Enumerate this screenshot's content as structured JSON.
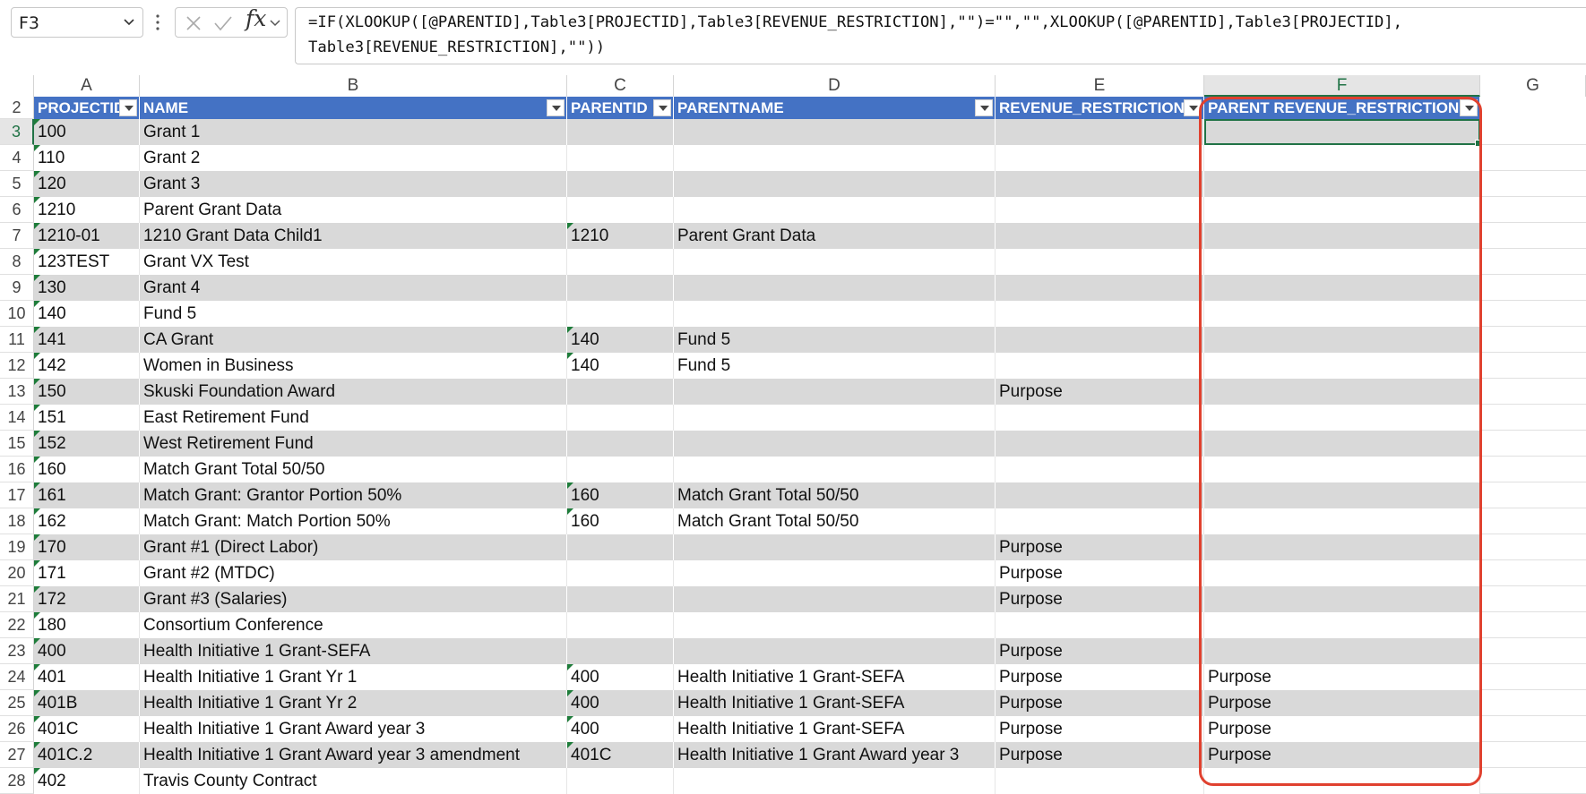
{
  "name_box": {
    "value": "F3"
  },
  "formula_bar": {
    "line1": "=IF(XLOOKUP([@PARENTID],Table3[PROJECTID],Table3[REVENUE_RESTRICTION],\"\")=\"\",\"\",XLOOKUP([@PARENTID],Table3[PROJECTID],",
    "line2": "Table3[REVENUE_RESTRICTION],\"\"))",
    "fx_label": "fx"
  },
  "columns": [
    "A",
    "B",
    "C",
    "D",
    "E",
    "F",
    "G"
  ],
  "table": {
    "header_row": "2",
    "headers": [
      "PROJECTID",
      "NAME",
      "PARENTID",
      "PARENTNAME",
      "REVENUE_RESTRICTION",
      "PARENT REVENUE_RESTRICTION"
    ],
    "rows": [
      {
        "row": "3",
        "projectid": "100",
        "name": "Grant 1",
        "parentid": "",
        "parentname": "",
        "rev": "",
        "parent_rev": ""
      },
      {
        "row": "4",
        "projectid": "110",
        "name": "Grant 2",
        "parentid": "",
        "parentname": "",
        "rev": "",
        "parent_rev": ""
      },
      {
        "row": "5",
        "projectid": "120",
        "name": "Grant 3",
        "parentid": "",
        "parentname": "",
        "rev": "",
        "parent_rev": ""
      },
      {
        "row": "6",
        "projectid": "1210",
        "name": "Parent Grant Data",
        "parentid": "",
        "parentname": "",
        "rev": "",
        "parent_rev": ""
      },
      {
        "row": "7",
        "projectid": "1210-01",
        "name": "1210 Grant Data Child1",
        "parentid": "1210",
        "parentname": "Parent Grant Data",
        "rev": "",
        "parent_rev": ""
      },
      {
        "row": "8",
        "projectid": "123TEST",
        "name": "Grant VX Test",
        "parentid": "",
        "parentname": "",
        "rev": "",
        "parent_rev": ""
      },
      {
        "row": "9",
        "projectid": "130",
        "name": "Grant 4",
        "parentid": "",
        "parentname": "",
        "rev": "",
        "parent_rev": ""
      },
      {
        "row": "10",
        "projectid": "140",
        "name": "Fund 5",
        "parentid": "",
        "parentname": "",
        "rev": "",
        "parent_rev": ""
      },
      {
        "row": "11",
        "projectid": "141",
        "name": "CA Grant",
        "parentid": "140",
        "parentname": "Fund 5",
        "rev": "",
        "parent_rev": ""
      },
      {
        "row": "12",
        "projectid": "142",
        "name": "Women in Business",
        "parentid": "140",
        "parentname": "Fund 5",
        "rev": "",
        "parent_rev": ""
      },
      {
        "row": "13",
        "projectid": "150",
        "name": "Skuski Foundation Award",
        "parentid": "",
        "parentname": "",
        "rev": "Purpose",
        "parent_rev": ""
      },
      {
        "row": "14",
        "projectid": "151",
        "name": "East Retirement Fund",
        "parentid": "",
        "parentname": "",
        "rev": "",
        "parent_rev": ""
      },
      {
        "row": "15",
        "projectid": "152",
        "name": "West Retirement Fund",
        "parentid": "",
        "parentname": "",
        "rev": "",
        "parent_rev": ""
      },
      {
        "row": "16",
        "projectid": "160",
        "name": "Match Grant Total 50/50",
        "parentid": "",
        "parentname": "",
        "rev": "",
        "parent_rev": ""
      },
      {
        "row": "17",
        "projectid": "161",
        "name": "Match Grant: Grantor Portion 50%",
        "parentid": "160",
        "parentname": "Match Grant Total 50/50",
        "rev": "",
        "parent_rev": ""
      },
      {
        "row": "18",
        "projectid": "162",
        "name": "Match Grant: Match Portion 50%",
        "parentid": "160",
        "parentname": "Match Grant Total 50/50",
        "rev": "",
        "parent_rev": ""
      },
      {
        "row": "19",
        "projectid": "170",
        "name": "Grant #1 (Direct Labor)",
        "parentid": "",
        "parentname": "",
        "rev": "Purpose",
        "parent_rev": ""
      },
      {
        "row": "20",
        "projectid": "171",
        "name": "Grant #2 (MTDC)",
        "parentid": "",
        "parentname": "",
        "rev": "Purpose",
        "parent_rev": ""
      },
      {
        "row": "21",
        "projectid": "172",
        "name": "Grant #3 (Salaries)",
        "parentid": "",
        "parentname": "",
        "rev": "Purpose",
        "parent_rev": ""
      },
      {
        "row": "22",
        "projectid": "180",
        "name": "Consortium Conference",
        "parentid": "",
        "parentname": "",
        "rev": "",
        "parent_rev": ""
      },
      {
        "row": "23",
        "projectid": "400",
        "name": "Health Initiative 1 Grant-SEFA",
        "parentid": "",
        "parentname": "",
        "rev": "Purpose",
        "parent_rev": ""
      },
      {
        "row": "24",
        "projectid": "401",
        "name": "Health Initiative 1 Grant Yr 1",
        "parentid": "400",
        "parentname": "Health Initiative 1 Grant-SEFA",
        "rev": "Purpose",
        "parent_rev": "Purpose"
      },
      {
        "row": "25",
        "projectid": "401B",
        "name": "Health Initiative 1 Grant Yr 2",
        "parentid": "400",
        "parentname": "Health Initiative 1 Grant-SEFA",
        "rev": "Purpose",
        "parent_rev": "Purpose"
      },
      {
        "row": "26",
        "projectid": "401C",
        "name": "Health Initiative 1 Grant Award year 3",
        "parentid": "400",
        "parentname": "Health Initiative 1 Grant-SEFA",
        "rev": "Purpose",
        "parent_rev": "Purpose"
      },
      {
        "row": "27",
        "projectid": "401C.2",
        "name": "Health Initiative 1 Grant Award year 3 amendment",
        "parentid": "401C",
        "parentname": "Health Initiative 1 Grant Award year 3",
        "rev": "Purpose",
        "parent_rev": "Purpose"
      },
      {
        "row": "28",
        "projectid": "402",
        "name": "Travis County Contract",
        "parentid": "",
        "parentname": "",
        "rev": "",
        "parent_rev": ""
      }
    ]
  },
  "colors": {
    "table_header": "#4472c4",
    "band_row": "#d9d9d9",
    "excel_green": "#217346",
    "highlight_box": "#e0412f"
  }
}
